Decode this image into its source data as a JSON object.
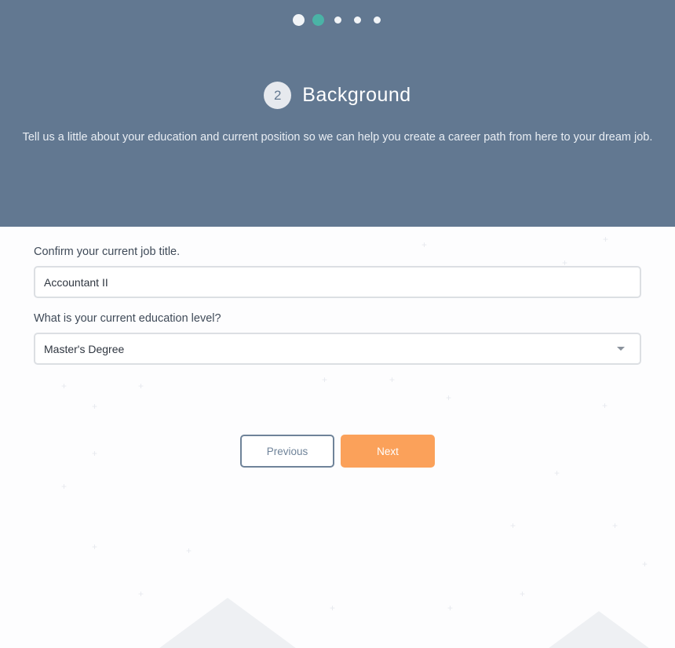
{
  "progress": {
    "current_step": 2,
    "total_steps": 5
  },
  "step": {
    "number": "2",
    "title": "Background",
    "description": "Tell us a little about your education and current position so we can help you create a career path from here to your dream job."
  },
  "form": {
    "job_title_label": "Confirm your current job title.",
    "job_title_value": "Accountant II",
    "education_label": "What is your current education level?",
    "education_value": "Master's Degree"
  },
  "actions": {
    "previous_label": "Previous",
    "next_label": "Next"
  },
  "colors": {
    "header_bg": "#627891",
    "active_dot": "#4ab3a6",
    "next_button": "#fba15a",
    "previous_border": "#6f8399"
  }
}
